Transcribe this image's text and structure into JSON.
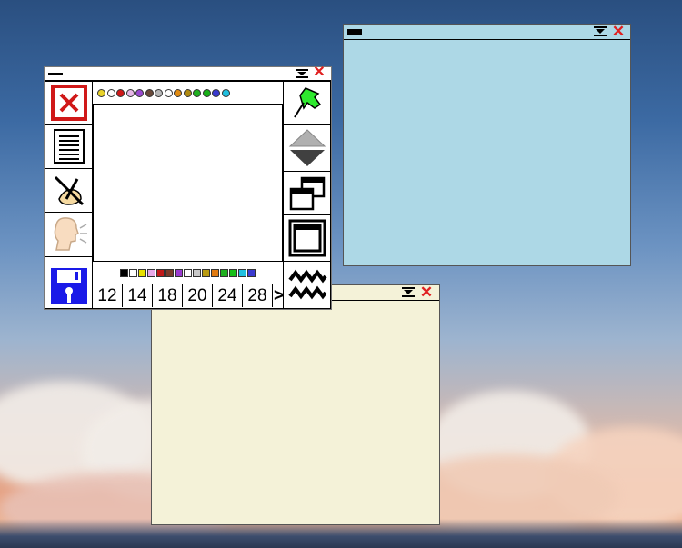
{
  "windows": {
    "blue_note": {
      "bg": "#add8e6"
    },
    "yellow_note": {
      "bg": "#f4f2d8"
    }
  },
  "toolbar": {
    "dot_colors": [
      "#e8d22a",
      "#ffffff",
      "#d01818",
      "#e8b8e8",
      "#9a4ad0",
      "#6a4a3a",
      "#b8b8b8",
      "#ffffff",
      "#e08a10",
      "#b08a10",
      "#20b020",
      "#18b018",
      "#3a3ad0",
      "#20c0e0"
    ],
    "square_colors": [
      "#000000",
      "#ffffff",
      "#e8e000",
      "#e8a8e8",
      "#c01818",
      "#7a3a2a",
      "#9a3ad0",
      "#ffffff",
      "#c8c8c8",
      "#b89a10",
      "#e07a10",
      "#20b020",
      "#18c018",
      "#20c0e0",
      "#3a3ad0"
    ],
    "sizes": [
      "12",
      "14",
      "18",
      "20",
      "24",
      "28"
    ],
    "more_label": ">",
    "icons": {
      "close": "close-icon",
      "document": "document-icon",
      "pen": "no-pen-icon",
      "speak": "speak-icon",
      "save": "floppy-disk-icon",
      "pin": "pushpin-icon",
      "updown": "scroll-updown-icon",
      "cascade": "cascade-windows-icon",
      "maximize": "maximize-window-icon",
      "wave": "wave-icon"
    }
  }
}
